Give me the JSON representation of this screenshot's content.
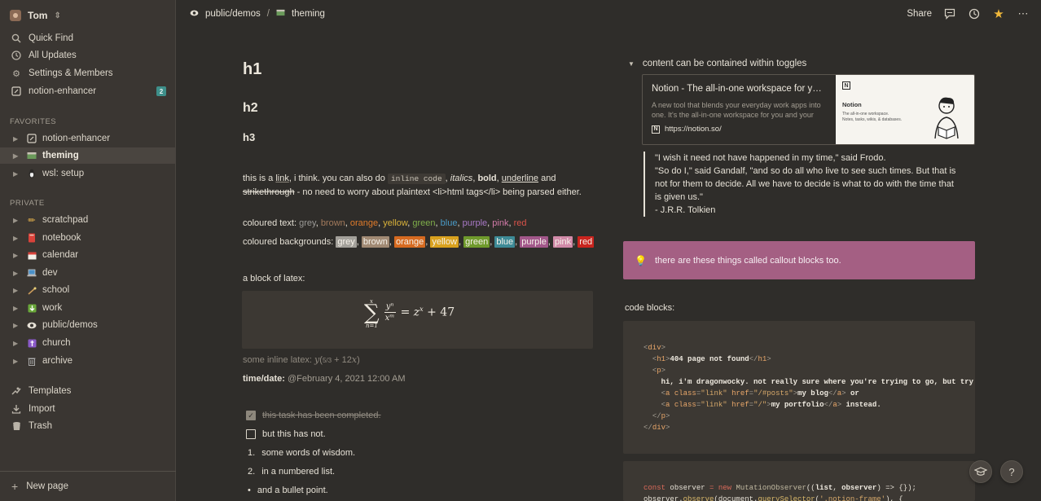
{
  "sidebar": {
    "workspace": "Tom",
    "top": [
      {
        "label": "Quick Find",
        "icon": "search-icon"
      },
      {
        "label": "All Updates",
        "icon": "clock-icon"
      },
      {
        "label": "Settings & Members",
        "icon": "gear-icon"
      },
      {
        "label": "notion-enhancer",
        "icon": "page-icon",
        "badge": "2"
      }
    ],
    "favorites_label": "FAVORITES",
    "favorites": [
      {
        "label": "notion-enhancer",
        "icon": "page-icon"
      },
      {
        "label": "theming",
        "icon": "palette-icon"
      },
      {
        "label": "wsl: setup",
        "icon": "penguin-icon"
      }
    ],
    "private_label": "PRIVATE",
    "private": [
      {
        "label": "scratchpad",
        "icon": "pencil-icon"
      },
      {
        "label": "notebook",
        "icon": "book-icon"
      },
      {
        "label": "calendar",
        "icon": "calendar-icon"
      },
      {
        "label": "dev",
        "icon": "laptop-icon"
      },
      {
        "label": "school",
        "icon": "school-icon"
      },
      {
        "label": "work",
        "icon": "briefcase-icon"
      },
      {
        "label": "public/demos",
        "icon": "eye-icon"
      },
      {
        "label": "church",
        "icon": "cross-icon"
      },
      {
        "label": "archive",
        "icon": "trash-can-icon"
      }
    ],
    "bottom": [
      {
        "label": "Templates",
        "icon": "templates-icon"
      },
      {
        "label": "Import",
        "icon": "import-icon"
      },
      {
        "label": "Trash",
        "icon": "trash-icon"
      }
    ],
    "new_page": "New page"
  },
  "topbar": {
    "crumb1": "public/demos",
    "crumb_sep": "/",
    "crumb2": "theming",
    "share": "Share"
  },
  "content": {
    "h1": "h1",
    "h2": "h2",
    "h3": "h3",
    "p_text1": "this is a ",
    "p_link": "link",
    "p_text2": ", i think. you can also do ",
    "p_code": "inline code",
    "p_text3": ", ",
    "p_italic": "italics",
    "p_text4": ", ",
    "p_bold": "bold",
    "p_text5": ", ",
    "p_underline": "underline",
    "p_text6": " and ",
    "p_strike": "strikethrough",
    "p_text7": " - no need to worry about plaintext <li>html tags</li> being parsed either.",
    "coloured_text_label": "coloured text: ",
    "coloured_text": [
      {
        "word": "grey",
        "color": "#9b9a97"
      },
      {
        "word": "brown",
        "color": "#a37a5c"
      },
      {
        "word": "orange",
        "color": "#e07b2a"
      },
      {
        "word": "yellow",
        "color": "#d9b23a"
      },
      {
        "word": "green",
        "color": "#7fae4a"
      },
      {
        "word": "blue",
        "color": "#4a9bc7"
      },
      {
        "word": "purple",
        "color": "#a979c7"
      },
      {
        "word": "pink",
        "color": "#d27aa8"
      },
      {
        "word": "red",
        "color": "#d9534a"
      }
    ],
    "coloured_bg_label": "coloured backgrounds: ",
    "coloured_bg": [
      {
        "word": "grey",
        "bg": "#a3a09a"
      },
      {
        "word": "brown",
        "bg": "#a18a74"
      },
      {
        "word": "orange",
        "bg": "#d66a20"
      },
      {
        "word": "yellow",
        "bg": "#d9a11e"
      },
      {
        "word": "green",
        "bg": "#6f9a2c"
      },
      {
        "word": "blue",
        "bg": "#3d8a96"
      },
      {
        "word": "purple",
        "bg": "#a2578a"
      },
      {
        "word": "pink",
        "bg": "#d18aa8"
      },
      {
        "word": "red",
        "bg": "#c9241e"
      }
    ],
    "latex_label": "a block of latex:",
    "inline_latex_label": "some inline latex: ",
    "time_label": "time/date: ",
    "time_value": "@February 4, 2021 12:00 AM",
    "todo_done": "this task has been completed.",
    "todo_open": "but this has not.",
    "ol": [
      "some words of wisdom.",
      "in a numbered list."
    ],
    "bullet": "and a bullet point."
  },
  "right": {
    "toggle": "content can be contained within toggles",
    "bookmark": {
      "title": "Notion - The all-in-one workspace for your notes, tasks, wikis, and databases.",
      "desc": "A new tool that blends your everyday work apps into one. It's the all-in-one workspace for you and your team",
      "url": "https://notion.so/",
      "img_logo": "N",
      "img_title": "Notion",
      "img_sub1": "The all-in-one workspace.",
      "img_sub2": "Notes, tasks, wikis, & databases."
    },
    "quote": [
      "\"I wish it need not have happened in my time,\" said Frodo.",
      "\"So do I,\" said Gandalf, \"and so do all who live to see such times. But that is not for them to decide. All we have to decide is what to do with the time that is given us.\"",
      "- J.R.R. Tolkien"
    ],
    "callout": "there are these things called callout blocks too.",
    "code_label": "code blocks:"
  },
  "colors": {
    "background": "#2f2d2a",
    "sidebar": "#3a3632",
    "accent_star": "#f0b83a",
    "callout": "#a45f83",
    "badge": "#3e8f8a"
  }
}
